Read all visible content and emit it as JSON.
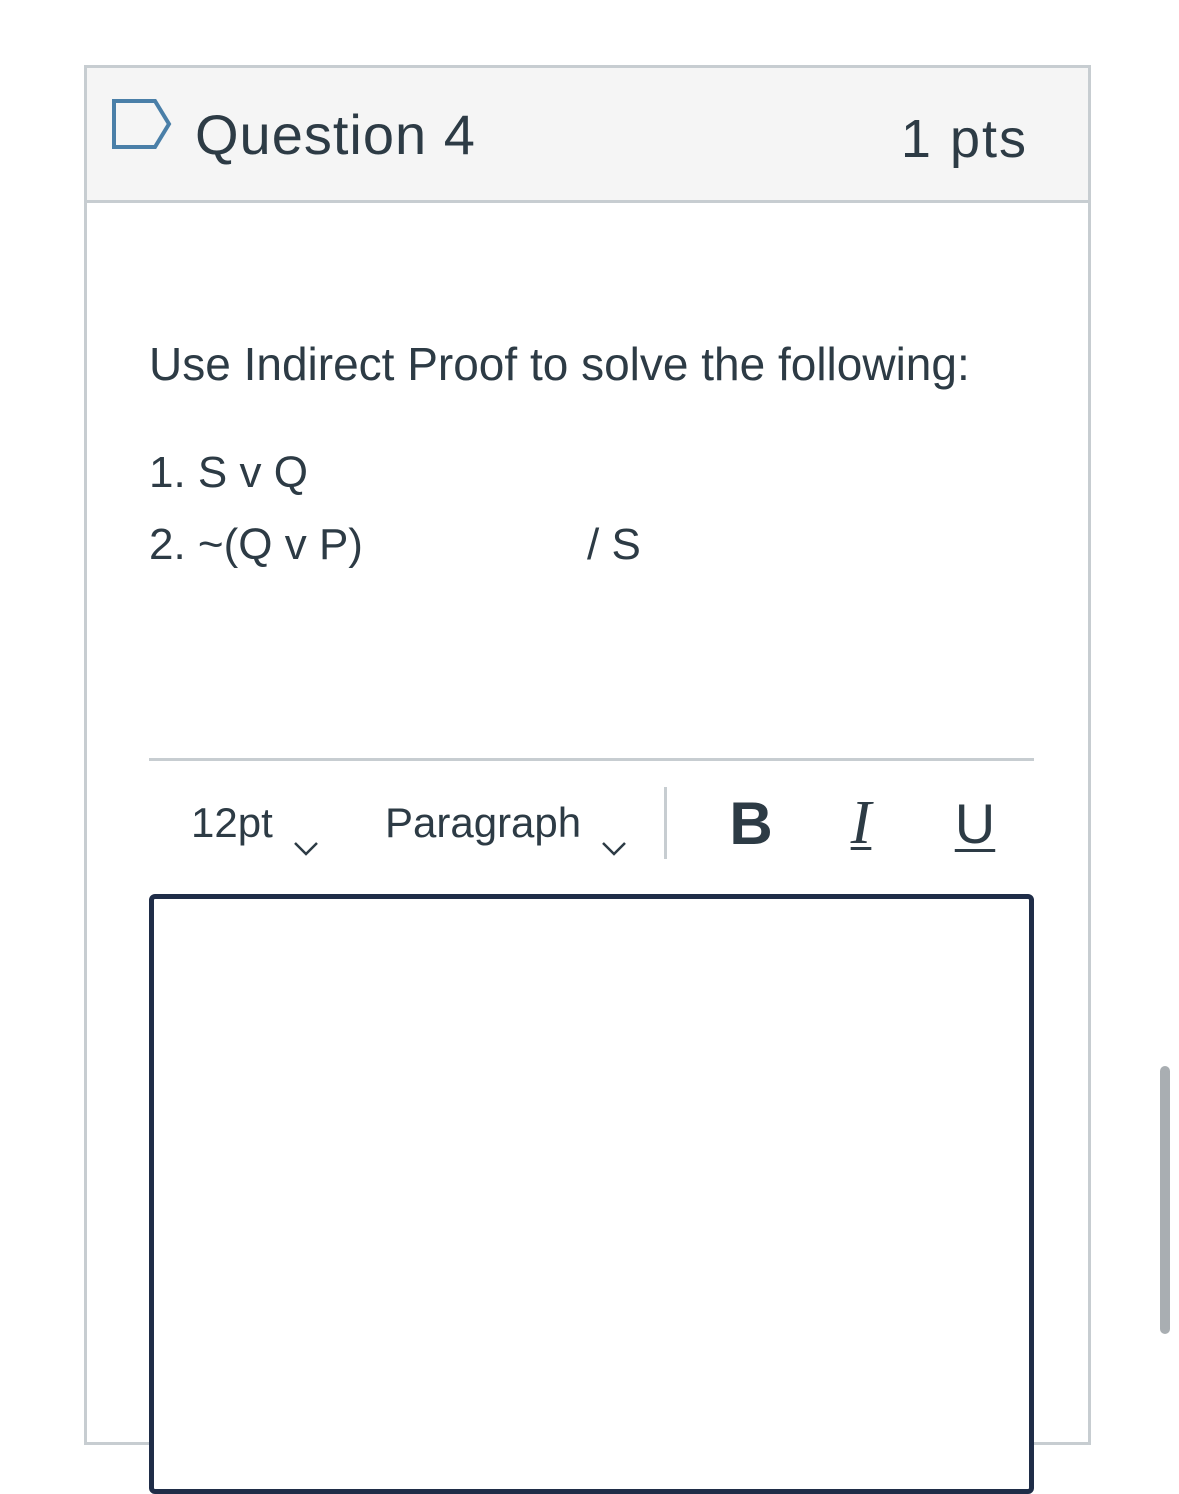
{
  "question": {
    "title": "Question 4",
    "points": "1 pts",
    "flag_icon": "flag-outline-icon",
    "prompt": "Use Indirect Proof to solve the following:",
    "premises": [
      "1. S v Q",
      "2. ~(Q v P)"
    ],
    "conclusion": "/ S"
  },
  "editor": {
    "font_size": "12pt",
    "block_format": "Paragraph",
    "bold_label": "B",
    "italic_label": "I",
    "underline_label": "U",
    "answer": ""
  },
  "colors": {
    "text": "#2d3b45",
    "border": "#c7cdd1",
    "header_bg": "#f5f5f5",
    "editor_border": "#1f2d48",
    "flag_stroke": "#4a7fa8"
  }
}
